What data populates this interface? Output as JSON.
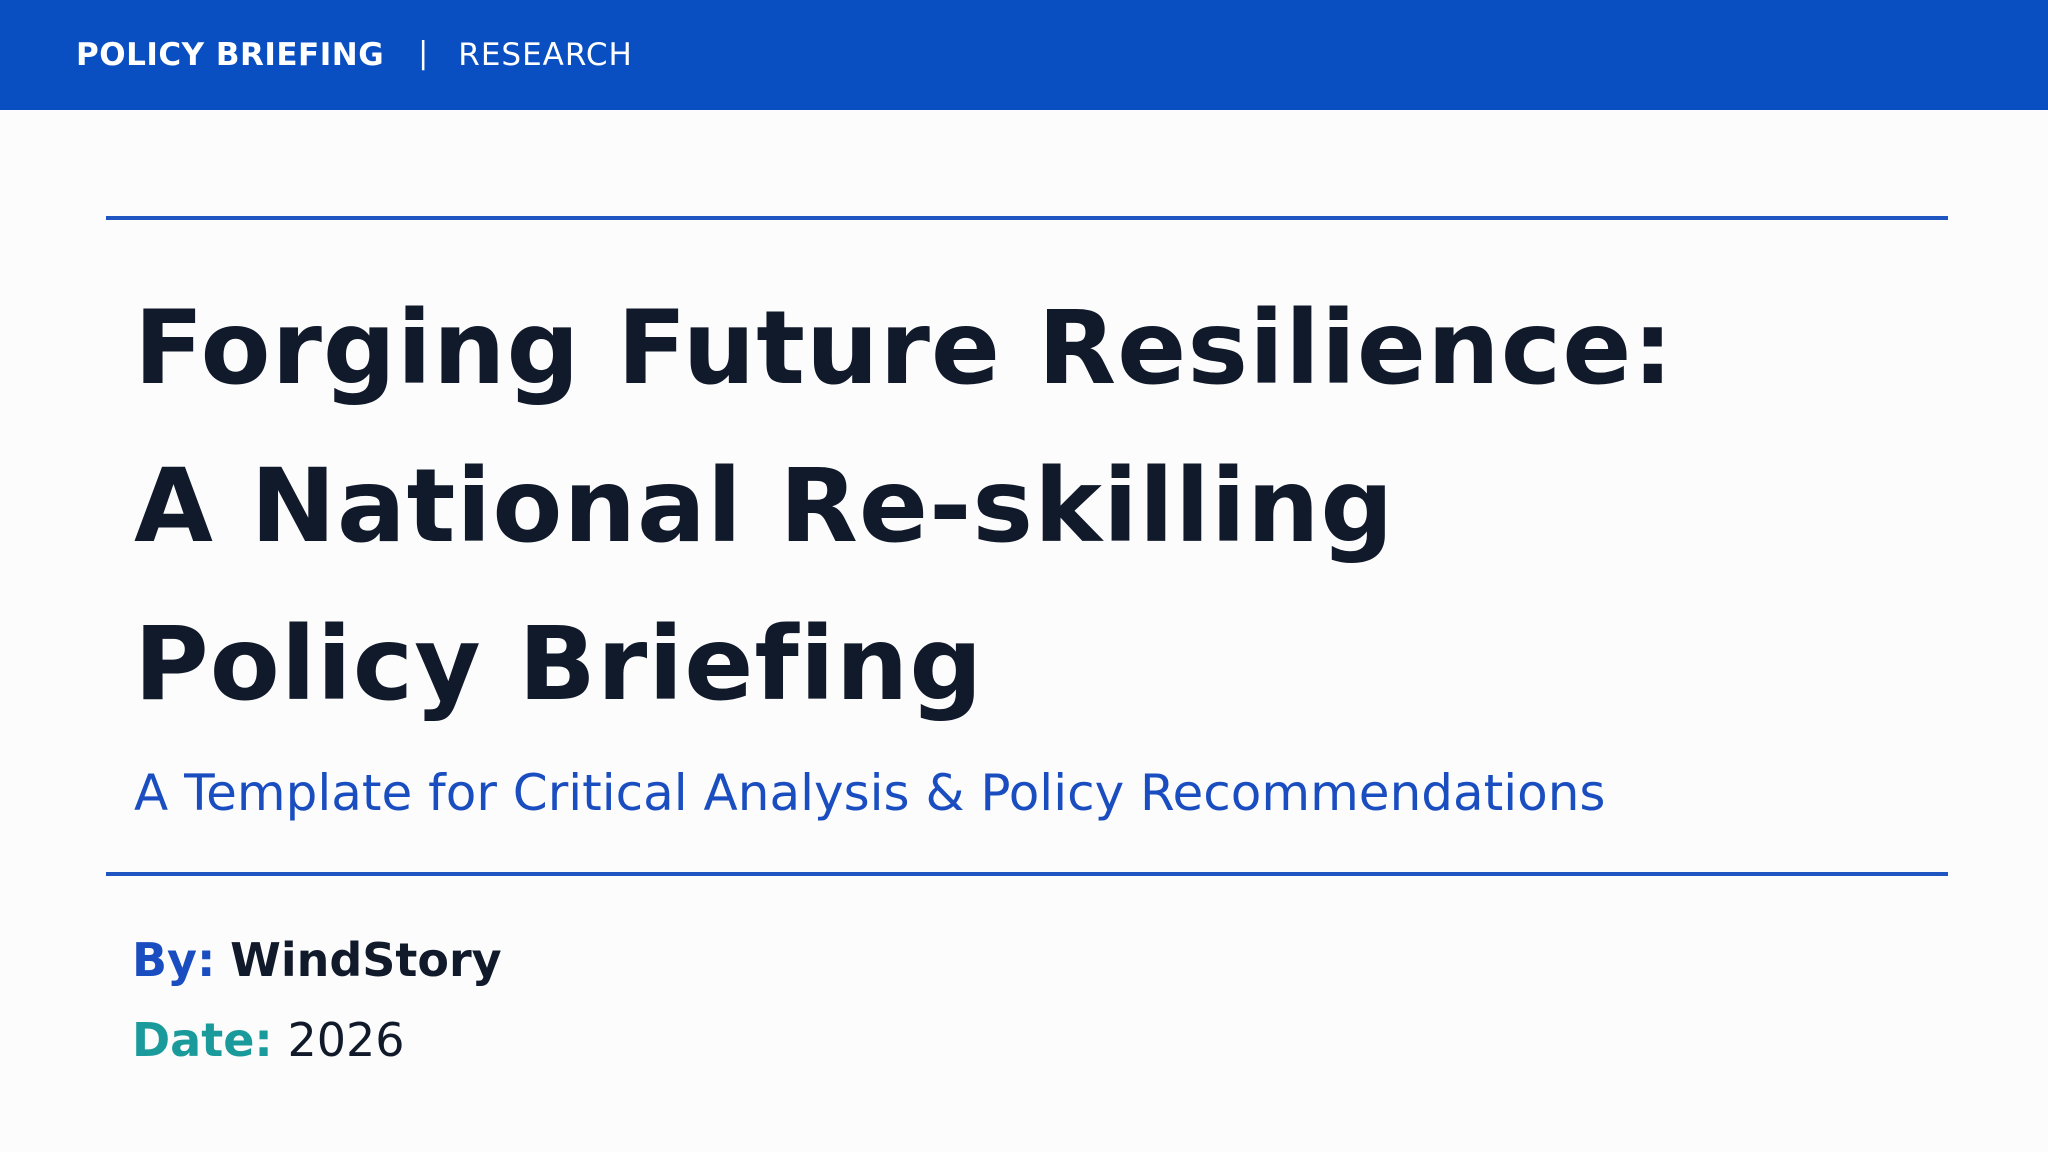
{
  "header": {
    "brand": "POLICY BRIEFING",
    "separator": "|",
    "section": "RESEARCH"
  },
  "document": {
    "title_lines": [
      "Forging Future Resilience:",
      "A National Re-skilling",
      "Policy Briefing"
    ],
    "subtitle": "A Template for Critical Analysis & Policy Recommendations",
    "author_label": "By:",
    "author": "WindStory",
    "date_label": "Date:",
    "date": "2026"
  },
  "colors": {
    "header_bg": "#0a4fc2",
    "accent_blue": "#1a4ec0",
    "accent_teal": "#1a9a9a",
    "title_text": "#111a2b",
    "background": "#fcfcfc"
  }
}
